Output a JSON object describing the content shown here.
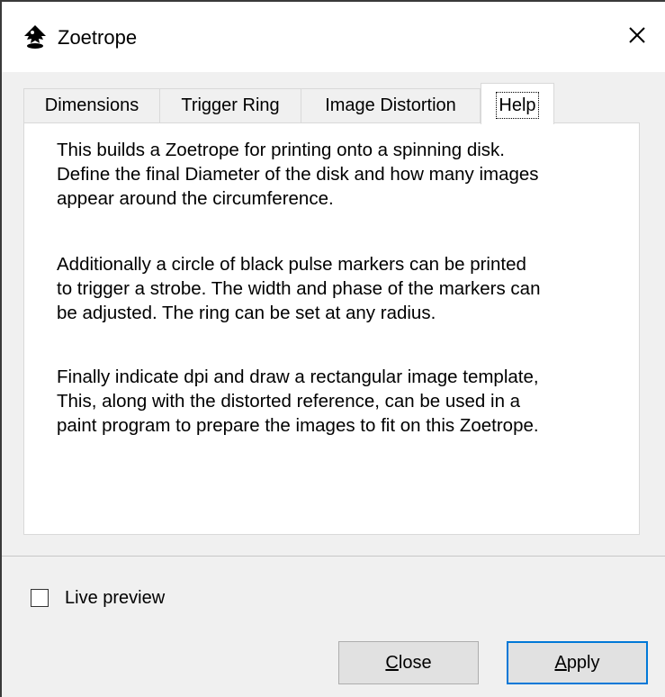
{
  "window": {
    "title": "Zoetrope",
    "app_icon": "inkscape-icon",
    "close_icon": "close-icon"
  },
  "tabs": [
    {
      "label": "Dimensions",
      "active": false
    },
    {
      "label": "Trigger Ring",
      "active": false
    },
    {
      "label": "Image Distortion",
      "active": false
    },
    {
      "label": "Help",
      "active": true
    }
  ],
  "help": {
    "paragraphs": [
      "This builds a Zoetrope for printing onto a spinning disk.\nDefine the final Diameter of the disk and how many images\nappear around the circumference.",
      "Additionally a circle of black pulse markers can be printed\nto trigger a strobe. The width and phase of the markers can\nbe adjusted. The ring can be set at any radius.",
      "Finally indicate dpi and draw a rectangular image template,\nThis, along with the distorted reference, can be used in a\npaint program to prepare the images to fit on this Zoetrope."
    ]
  },
  "live_preview": {
    "label": "Live preview",
    "checked": false
  },
  "buttons": {
    "close": {
      "mnemonic": "C",
      "rest": "lose"
    },
    "apply": {
      "mnemonic": "A",
      "rest": "pply"
    }
  },
  "colors": {
    "accent": "#0078d7"
  }
}
